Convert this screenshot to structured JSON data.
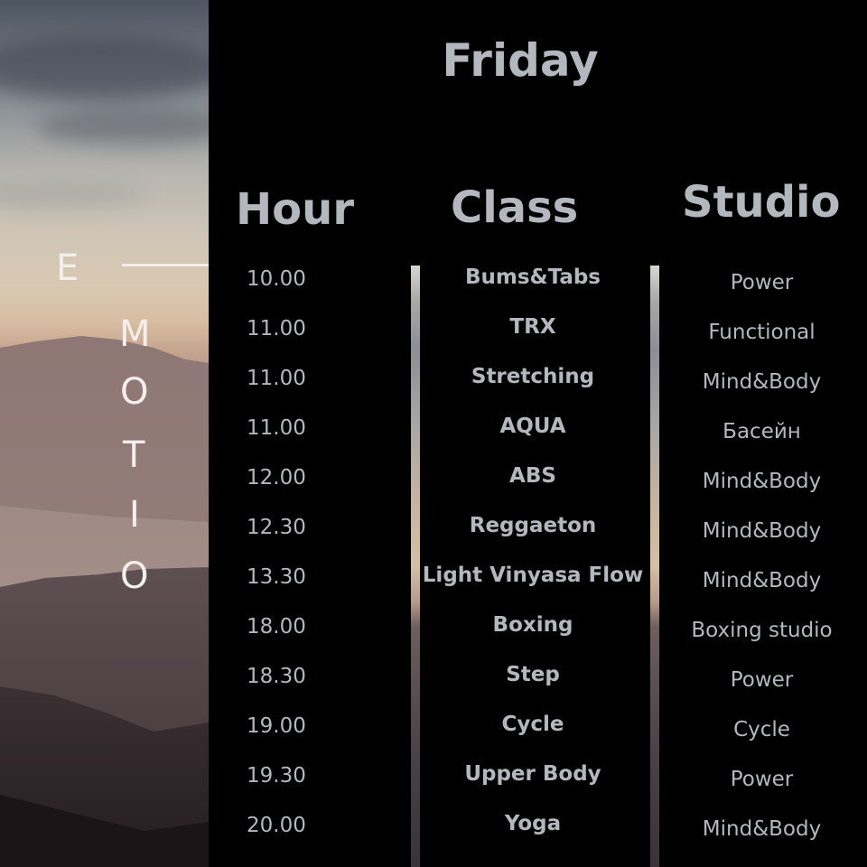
{
  "brand": {
    "letters": [
      "E",
      "M",
      "O",
      "T",
      "I",
      "O"
    ]
  },
  "schedule": {
    "day": "Friday",
    "headers": {
      "hour": "Hour",
      "class": "Class",
      "studio": "Studio"
    },
    "rows": [
      {
        "hour": "10.00",
        "class": "Bums&Tabs",
        "studio": "Power"
      },
      {
        "hour": "11.00",
        "class": "TRX",
        "studio": "Functional"
      },
      {
        "hour": "11.00",
        "class": "Stretching",
        "studio": "Mind&Body"
      },
      {
        "hour": "11.00",
        "class": "AQUA",
        "studio": "Басейн"
      },
      {
        "hour": "12.00",
        "class": "ABS",
        "studio": "Mind&Body"
      },
      {
        "hour": "12.30",
        "class": "Reggaeton",
        "studio": "Mind&Body"
      },
      {
        "hour": "13.30",
        "class": "Light Vinyasa Flow",
        "studio": "Mind&Body"
      },
      {
        "hour": "18.00",
        "class": "Boxing",
        "studio": "Boxing studio"
      },
      {
        "hour": "18.30",
        "class": "Step",
        "studio": "Power"
      },
      {
        "hour": "19.00",
        "class": "Cycle",
        "studio": "Cycle"
      },
      {
        "hour": "19.30",
        "class": "Upper Body",
        "studio": "Power"
      },
      {
        "hour": "20.00",
        "class": "Yoga",
        "studio": "Mind&Body"
      }
    ]
  }
}
